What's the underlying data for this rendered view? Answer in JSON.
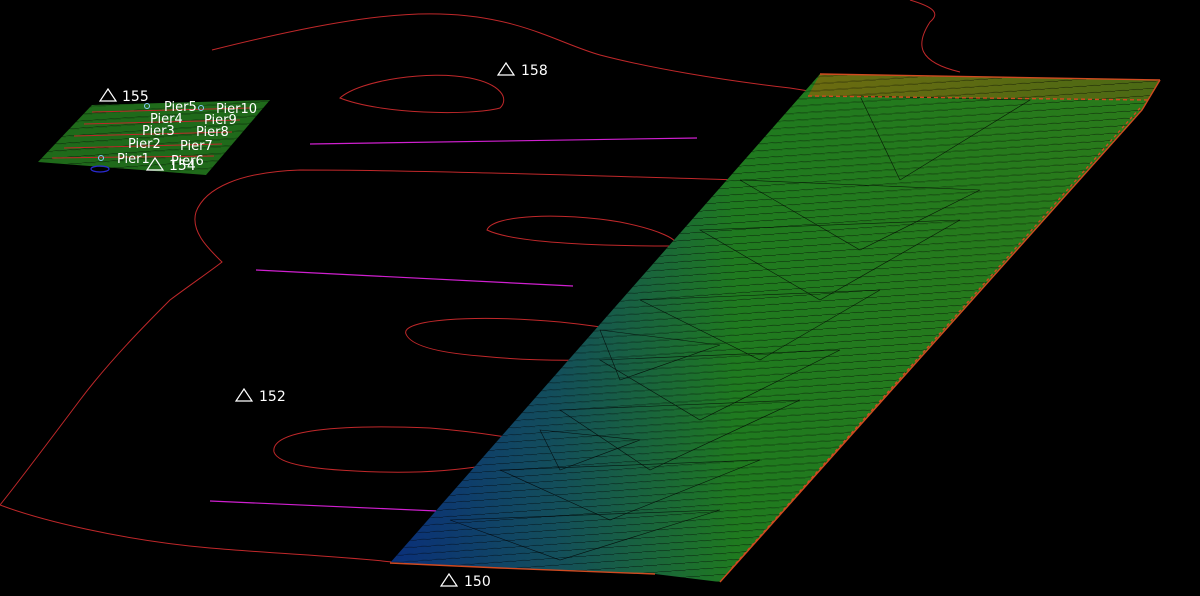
{
  "viewport": {
    "background": "#000000",
    "contour_color": "#c0282a",
    "guide_line_color": "#d020d0",
    "surface_colors": [
      "#1f7a1f",
      "#0a2f7a",
      "#6b6b10"
    ]
  },
  "elevation_markers": [
    {
      "label": "155",
      "icon": "triangle-icon"
    },
    {
      "label": "158",
      "icon": "triangle-icon"
    },
    {
      "label": "154",
      "icon": "triangle-icon"
    },
    {
      "label": "152",
      "icon": "triangle-icon"
    },
    {
      "label": "150",
      "icon": "triangle-icon"
    }
  ],
  "pier_labels": [
    "Pier5",
    "Pier10",
    "Pier4",
    "Pier9",
    "Pier3",
    "Pier8",
    "Pier2",
    "Pier7",
    "Pier1",
    "Pier6"
  ]
}
